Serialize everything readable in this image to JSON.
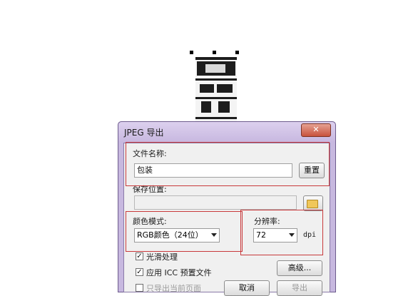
{
  "dialog": {
    "title": "JPEG 导出",
    "close_icon": "close-icon"
  },
  "filename": {
    "label": "文件名称:",
    "value": "包装",
    "reset_button": "重置"
  },
  "save_location": {
    "label": "保存位置:",
    "value": "",
    "browse_icon": "folder-icon"
  },
  "color_mode": {
    "label": "颜色模式:",
    "value": "RGB颜色（24位）"
  },
  "resolution": {
    "label": "分辨率:",
    "value": "72",
    "unit": "dpi"
  },
  "options": {
    "smooth": {
      "label": "光滑处理",
      "checked": true
    },
    "icc": {
      "label": "应用 ICC 预置文件",
      "checked": true
    },
    "current_page": {
      "label": "只导出当前页面",
      "checked": false
    }
  },
  "buttons": {
    "advanced": "高级...",
    "ok": "导出",
    "cancel": "取消"
  },
  "colors": {
    "dialog_frame": "#c7b8df",
    "highlight": "#c8393b",
    "close_button": "#c8523c"
  }
}
